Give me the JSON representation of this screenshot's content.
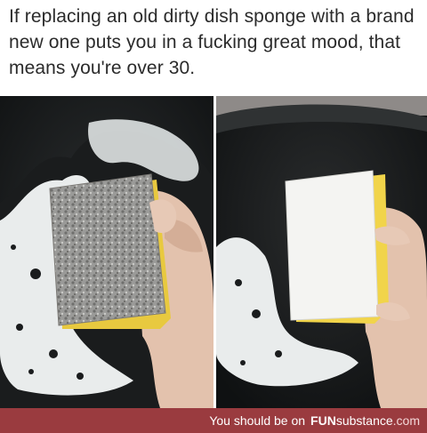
{
  "caption": "If replacing an old dirty dish sponge with a brand new one puts you in a fucking great mood, that means you're over 30.",
  "footer": {
    "prefix": "You should be on",
    "brand_fun": "FUN",
    "brand_sub": "substance",
    "brand_tld": ".com"
  },
  "colors": {
    "footer_bg": "#9a3b3f",
    "pan": "#1b1d1e",
    "foam": "#eef0f0",
    "sponge_white": "#f4f4f2",
    "sponge_yellow": "#f1d44a",
    "skin": "#e7c9b6"
  },
  "photos": {
    "left": "old-dirty-sponge-photo",
    "right": "new-clean-sponge-photo"
  }
}
